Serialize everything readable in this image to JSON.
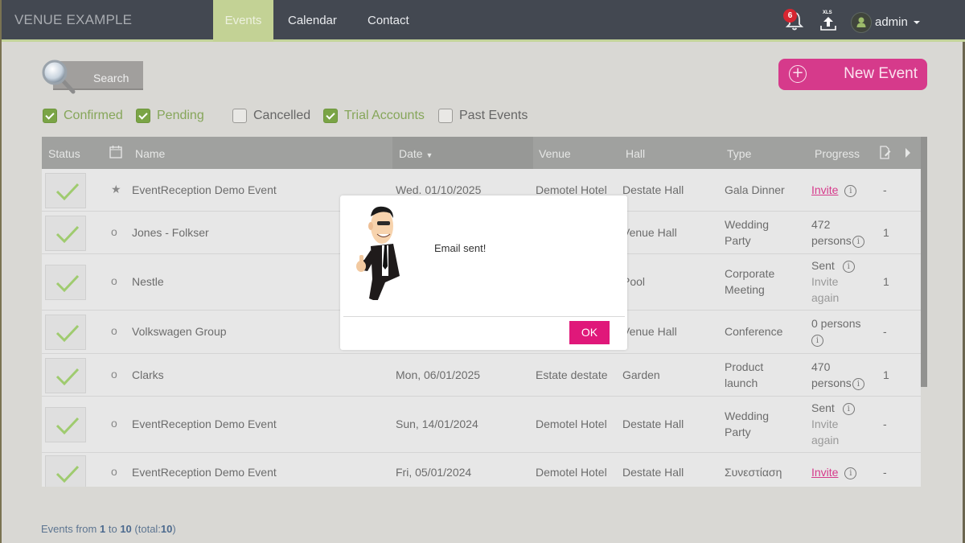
{
  "app": {
    "brand": "VENUE EXAMPLE",
    "nav": [
      {
        "label": "Events",
        "active": true
      },
      {
        "label": "Calendar",
        "active": false
      },
      {
        "label": "Contact",
        "active": false
      }
    ],
    "notifications_count": "6",
    "export_label": "XLS",
    "user": "admin"
  },
  "toolbar": {
    "search_label": "Search",
    "new_event_label": "New Event",
    "new_event_icon": "+"
  },
  "filters": [
    {
      "label": "Confirmed",
      "checked": true
    },
    {
      "label": "Pending",
      "checked": true
    },
    {
      "label": "Cancelled",
      "checked": false
    },
    {
      "label": "Trial Accounts",
      "checked": true
    },
    {
      "label": "Past Events",
      "checked": false
    }
  ],
  "table": {
    "columns": {
      "status": "Status",
      "name": "Name",
      "date": "Date",
      "venue": "Venue",
      "hall": "Hall",
      "type": "Type",
      "progress": "Progress"
    },
    "rows": [
      {
        "marker": "★",
        "name": "EventReception Demo Event",
        "date": "Wed. 01/10/2025",
        "venue": "Demotel Hotel",
        "hall": "Destate Hall",
        "type": "Gala Dinner",
        "progress_main": "Invite",
        "progress_sub": "",
        "progress_kind": "link",
        "last": "-"
      },
      {
        "marker": "o",
        "name": "Jones - Folkser",
        "date": "",
        "venue": "",
        "hall": "Venue Hall",
        "type": "Wedding Party",
        "progress_main": "472",
        "progress_sub": "persons",
        "progress_kind": "persons",
        "last": "1"
      },
      {
        "marker": "o",
        "name": "Nestle",
        "date": "",
        "venue": "",
        "hall": "Pool",
        "type": "Corporate Meeting",
        "progress_main": "Sent",
        "progress_sub": "Invite again",
        "progress_kind": "sent",
        "last": "1"
      },
      {
        "marker": "o",
        "name": "Volkswagen Group",
        "date": "",
        "venue": "",
        "hall": "Venue Hall",
        "type": "Conference",
        "progress_main": "0 persons",
        "progress_sub": "",
        "progress_kind": "persons0",
        "last": "-"
      },
      {
        "marker": "o",
        "name": "Clarks",
        "date": "Mon, 06/01/2025",
        "venue": "Estate destate",
        "hall": "Garden",
        "type": "Product launch",
        "progress_main": "470",
        "progress_sub": "persons",
        "progress_kind": "persons",
        "last": "1"
      },
      {
        "marker": "o",
        "name": "EventReception Demo Event",
        "date": "Sun, 14/01/2024",
        "venue": "Demotel Hotel",
        "hall": "Destate Hall",
        "type": "Wedding Party",
        "progress_main": "Sent",
        "progress_sub": "Invite again",
        "progress_kind": "sent",
        "last": "-"
      },
      {
        "marker": "o",
        "name": "EventReception Demo Event",
        "date": "Fri, 05/01/2024",
        "venue": "Demotel Hotel",
        "hall": "Destate Hall",
        "type": "Συνεστίαση",
        "progress_main": "Invite",
        "progress_sub": "",
        "progress_kind": "link",
        "last": "-"
      }
    ]
  },
  "footer": {
    "prefix": "Events from",
    "from": "1",
    "to_word": "to",
    "to": "10",
    "total_prefix": "(total:",
    "total": "10",
    "total_suffix": ")"
  },
  "modal": {
    "message": "Email sent!",
    "ok_label": "OK"
  },
  "colors": {
    "accent": "#d63a8b",
    "nav_bg": "#434851",
    "nav_active": "#c3d295",
    "check_green": "#7aa446"
  }
}
